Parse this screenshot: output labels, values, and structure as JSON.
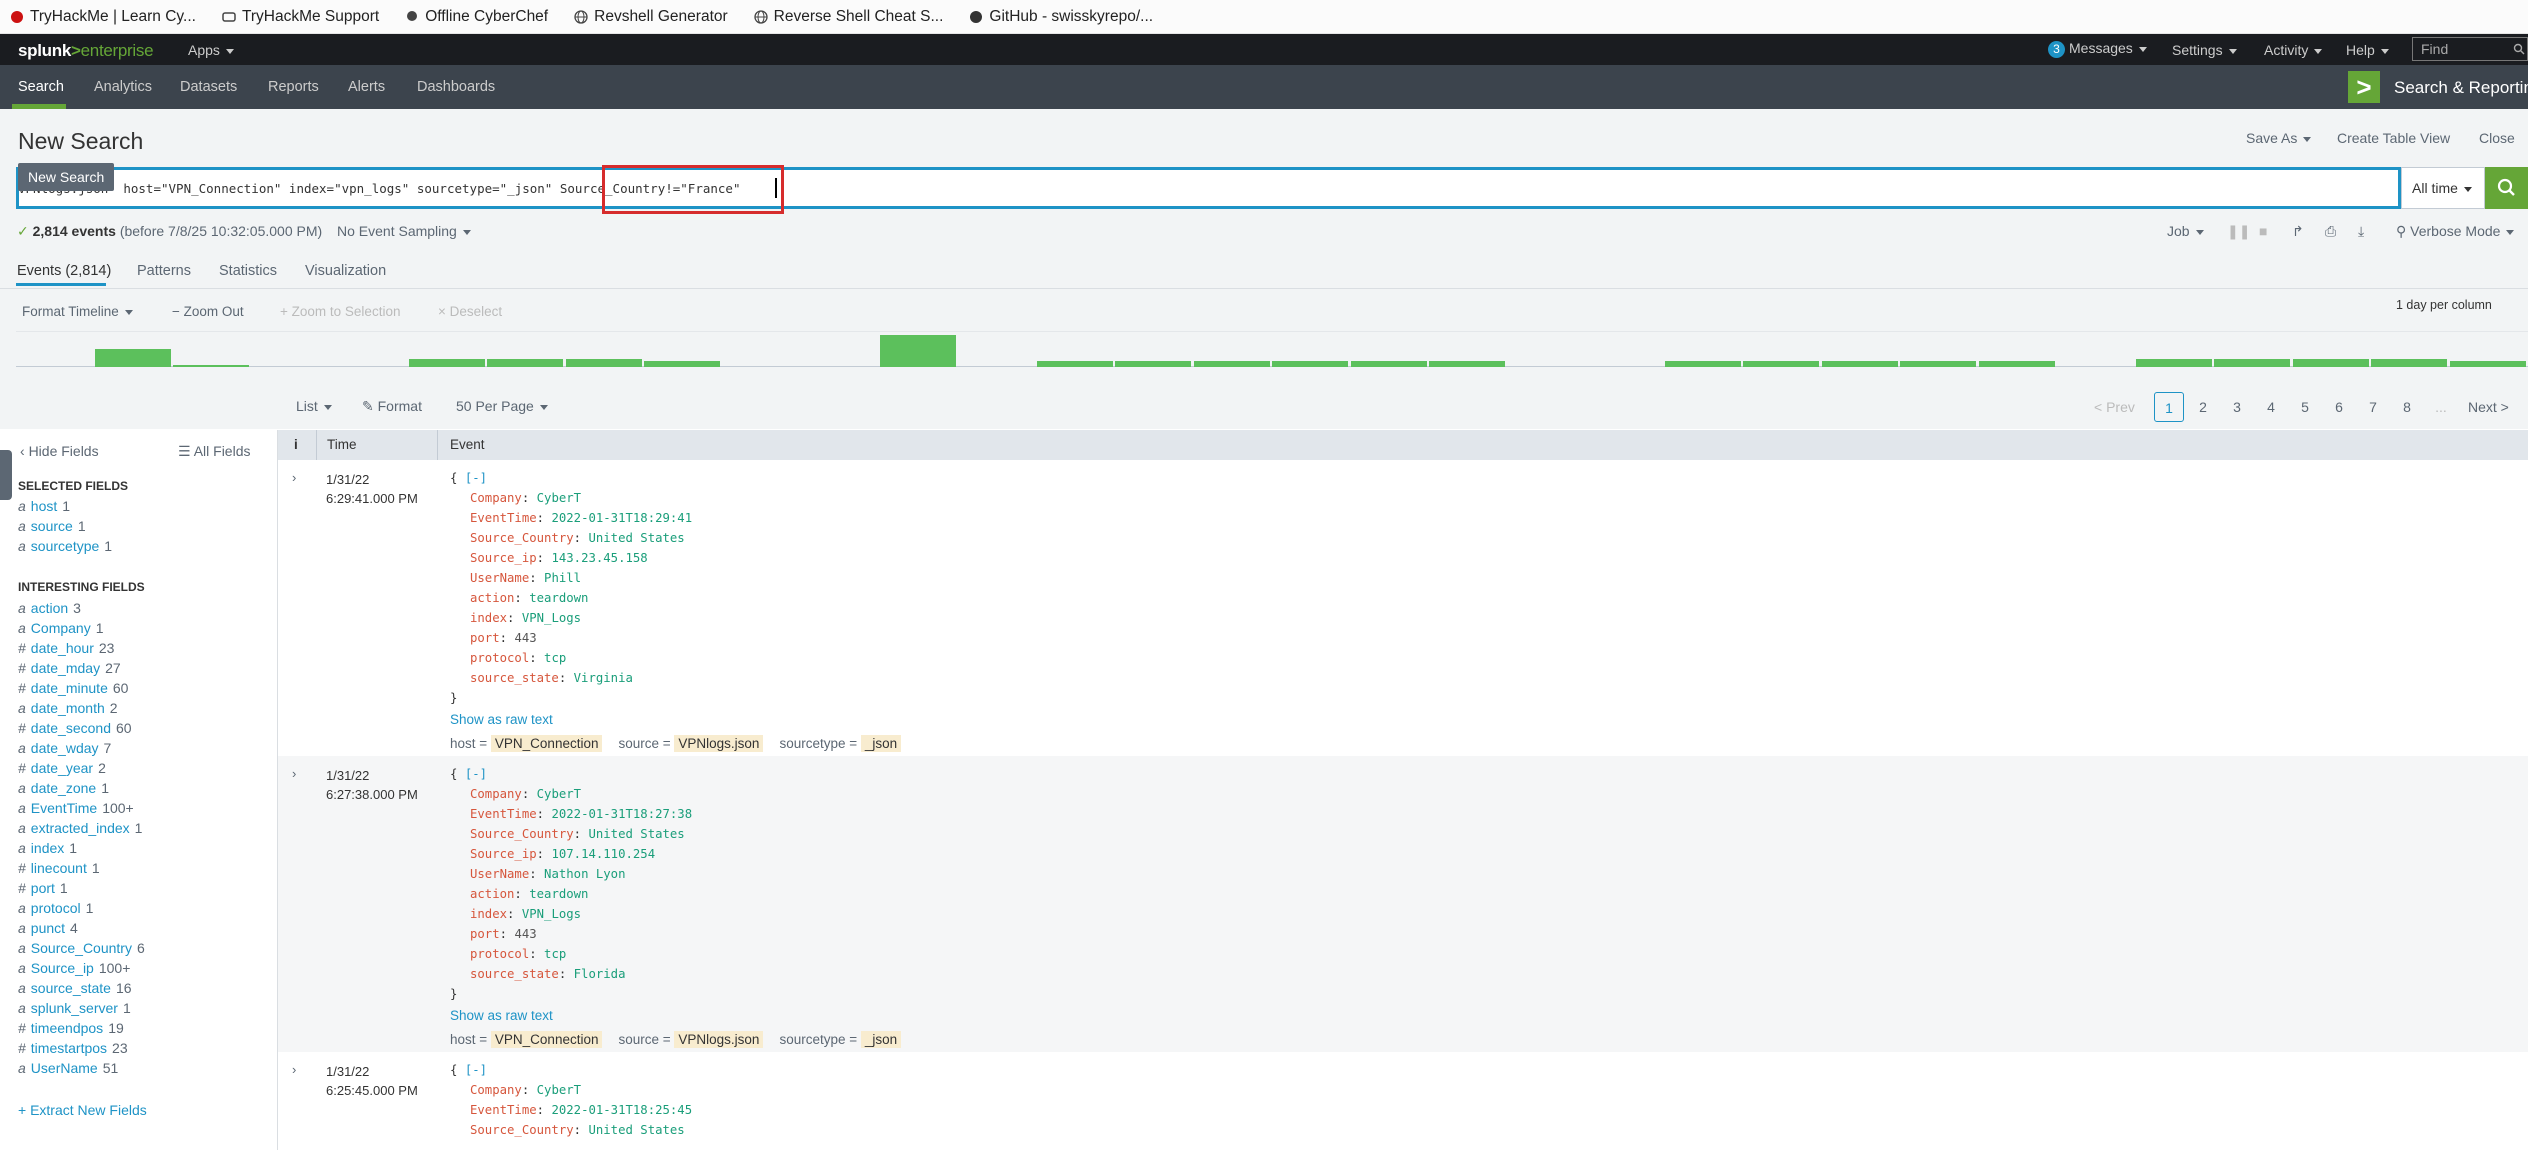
{
  "bookmarks": [
    {
      "label": "TryHackMe | Learn Cy...",
      "icon": "tryhackme-icon"
    },
    {
      "label": "TryHackMe Support",
      "icon": "support-icon"
    },
    {
      "label": "Offline CyberChef",
      "icon": "chef-icon"
    },
    {
      "label": "Revshell Generator",
      "icon": "globe-icon"
    },
    {
      "label": "Reverse Shell Cheat S...",
      "icon": "globe-icon"
    },
    {
      "label": "GitHub - swisskyrepo/...",
      "icon": "github-icon"
    }
  ],
  "header": {
    "logo_main": "splunk",
    "logo_gt": ">",
    "logo_sub": "enterprise",
    "apps": "Apps",
    "messages_count": "3",
    "messages": "Messages",
    "settings": "Settings",
    "activity": "Activity",
    "help": "Help",
    "find_placeholder": "Find"
  },
  "appnav": {
    "items": [
      "Search",
      "Analytics",
      "Datasets",
      "Reports",
      "Alerts",
      "Dashboards"
    ],
    "app_title": "Search & Reporting"
  },
  "search": {
    "page_title": "New Search",
    "tooltip": "New Search",
    "save_as": "Save As",
    "create_table_view": "Create Table View",
    "close": "Close",
    "query_prefix": "VPNlogs.json\" host=\"VPN_Connection\" index=\"vpn_logs\" sourcetype=\"_json\" ",
    "query_highlight": "Source_Country!=\"France\"",
    "time_range": "All time",
    "status_count": "2,814 events",
    "status_rest": "(before 7/8/25 10:32:05.000 PM)",
    "sampling": "No Event Sampling",
    "job": "Job",
    "mode": "Verbose Mode"
  },
  "tabs": [
    "Events (2,814)",
    "Patterns",
    "Statistics",
    "Visualization"
  ],
  "timeline": {
    "format": "Format Timeline",
    "zoom_out": "Zoom Out",
    "zoom_sel": "Zoom to Selection",
    "deselect": "Deselect",
    "scale": "1 day per column",
    "bars": [
      0,
      0.55,
      0.05,
      0,
      0,
      0.25,
      0.25,
      0.25,
      0.2,
      0,
      0,
      1.0,
      0,
      0.2,
      0.2,
      0.2,
      0.2,
      0.2,
      0.2,
      0,
      0,
      0.2,
      0.2,
      0.2,
      0.2,
      0.2,
      0,
      0.25,
      0.25,
      0.25,
      0.25,
      0.2,
      0.2
    ]
  },
  "listbar": {
    "list": "List",
    "format": "Format",
    "per_page": "50 Per Page",
    "prev": "< Prev",
    "pages": [
      "1",
      "2",
      "3",
      "4",
      "5",
      "6",
      "7",
      "8"
    ],
    "ellipsis": "...",
    "next": "Next >"
  },
  "sidebar": {
    "hide_fields": "Hide Fields",
    "all_fields": "All Fields",
    "selected_title": "SELECTED FIELDS",
    "selected": [
      {
        "t": "a",
        "name": "host",
        "count": "1"
      },
      {
        "t": "a",
        "name": "source",
        "count": "1"
      },
      {
        "t": "a",
        "name": "sourcetype",
        "count": "1"
      }
    ],
    "interesting_title": "INTERESTING FIELDS",
    "interesting": [
      {
        "t": "a",
        "name": "action",
        "count": "3"
      },
      {
        "t": "a",
        "name": "Company",
        "count": "1"
      },
      {
        "t": "#",
        "name": "date_hour",
        "count": "23"
      },
      {
        "t": "#",
        "name": "date_mday",
        "count": "27"
      },
      {
        "t": "#",
        "name": "date_minute",
        "count": "60"
      },
      {
        "t": "a",
        "name": "date_month",
        "count": "2"
      },
      {
        "t": "#",
        "name": "date_second",
        "count": "60"
      },
      {
        "t": "a",
        "name": "date_wday",
        "count": "7"
      },
      {
        "t": "#",
        "name": "date_year",
        "count": "2"
      },
      {
        "t": "a",
        "name": "date_zone",
        "count": "1"
      },
      {
        "t": "a",
        "name": "EventTime",
        "count": "100+"
      },
      {
        "t": "a",
        "name": "extracted_index",
        "count": "1"
      },
      {
        "t": "a",
        "name": "index",
        "count": "1"
      },
      {
        "t": "#",
        "name": "linecount",
        "count": "1"
      },
      {
        "t": "#",
        "name": "port",
        "count": "1"
      },
      {
        "t": "a",
        "name": "protocol",
        "count": "1"
      },
      {
        "t": "a",
        "name": "punct",
        "count": "4"
      },
      {
        "t": "a",
        "name": "Source_Country",
        "count": "6"
      },
      {
        "t": "a",
        "name": "Source_ip",
        "count": "100+"
      },
      {
        "t": "a",
        "name": "source_state",
        "count": "16"
      },
      {
        "t": "a",
        "name": "splunk_server",
        "count": "1"
      },
      {
        "t": "#",
        "name": "timeendpos",
        "count": "19"
      },
      {
        "t": "#",
        "name": "timestartpos",
        "count": "23"
      },
      {
        "t": "a",
        "name": "UserName",
        "count": "51"
      }
    ],
    "extract": "+ Extract New Fields"
  },
  "table": {
    "col_i": "i",
    "col_time": "Time",
    "col_event": "Event"
  },
  "events": [
    {
      "date": "1/31/22",
      "time": "6:29:41.000 PM",
      "fields": [
        {
          "k": "Company",
          "v": "CyberT"
        },
        {
          "k": "EventTime",
          "v": "2022-01-31T18:29:41"
        },
        {
          "k": "Source_Country",
          "v": "United States"
        },
        {
          "k": "Source_ip",
          "v": "143.23.45.158"
        },
        {
          "k": "UserName",
          "v": "Phill"
        },
        {
          "k": "action",
          "v": "teardown"
        },
        {
          "k": "index",
          "v": "VPN_Logs"
        },
        {
          "k": "port",
          "v": "443",
          "num": true
        },
        {
          "k": "protocol",
          "v": "tcp"
        },
        {
          "k": "source_state",
          "v": "Virginia"
        }
      ],
      "raw": "Show as raw text",
      "host": "VPN_Connection",
      "source": "VPNlogs.json",
      "sourcetype": "_json"
    },
    {
      "date": "1/31/22",
      "time": "6:27:38.000 PM",
      "fields": [
        {
          "k": "Company",
          "v": "CyberT"
        },
        {
          "k": "EventTime",
          "v": "2022-01-31T18:27:38"
        },
        {
          "k": "Source_Country",
          "v": "United States"
        },
        {
          "k": "Source_ip",
          "v": "107.14.110.254"
        },
        {
          "k": "UserName",
          "v": "Nathon Lyon"
        },
        {
          "k": "action",
          "v": "teardown"
        },
        {
          "k": "index",
          "v": "VPN_Logs"
        },
        {
          "k": "port",
          "v": "443",
          "num": true
        },
        {
          "k": "protocol",
          "v": "tcp"
        },
        {
          "k": "source_state",
          "v": "Florida"
        }
      ],
      "raw": "Show as raw text",
      "host": "VPN_Connection",
      "source": "VPNlogs.json",
      "sourcetype": "_json"
    },
    {
      "date": "1/31/22",
      "time": "6:25:45.000 PM",
      "fields": [
        {
          "k": "Company",
          "v": "CyberT"
        },
        {
          "k": "EventTime",
          "v": "2022-01-31T18:25:45"
        },
        {
          "k": "Source_Country",
          "v": "United States"
        }
      ],
      "raw": "",
      "host": "",
      "source": "",
      "sourcetype": ""
    }
  ],
  "colors": {
    "accent": "#65a637",
    "blue": "#1e93c6",
    "highlight": "#d62c2c"
  }
}
